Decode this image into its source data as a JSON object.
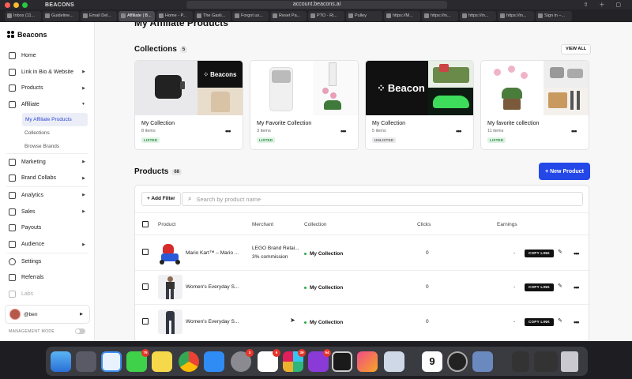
{
  "browser": {
    "app_name": "BEACONS",
    "url": "account.beacons.ai",
    "tabs": [
      {
        "label": "Inbox (11..."
      },
      {
        "label": "Guideline..."
      },
      {
        "label": "Email Del..."
      },
      {
        "label": "Affiliate | B..."
      },
      {
        "label": "Home - P..."
      },
      {
        "label": "The Gasli..."
      },
      {
        "label": "Forgot us..."
      },
      {
        "label": "Reset Pa..."
      },
      {
        "label": "PTO - Ri..."
      },
      {
        "label": "Pulley"
      },
      {
        "label": "https://M..."
      },
      {
        "label": "https://in..."
      },
      {
        "label": "https://in..."
      },
      {
        "label": "https://in..."
      },
      {
        "label": "Sign in –..."
      }
    ]
  },
  "sidebar": {
    "brand": "Beacons",
    "items": [
      {
        "label": "Home",
        "icon": "home-icon"
      },
      {
        "label": "Link in Bio & Website",
        "icon": "link-icon"
      },
      {
        "label": "Products",
        "icon": "tag-icon"
      },
      {
        "label": "Affiliate",
        "icon": "cart-icon"
      }
    ],
    "affiliate_sub": [
      "My Affiliate Products",
      "Collections",
      "Browse Brands"
    ],
    "items2": [
      {
        "label": "Marketing",
        "icon": "megaphone-icon"
      },
      {
        "label": "Brand Collabs",
        "icon": "handshake-icon"
      }
    ],
    "items3": [
      {
        "label": "Analytics",
        "icon": "chart-icon"
      },
      {
        "label": "Sales",
        "icon": "wallet-icon"
      },
      {
        "label": "Payouts",
        "icon": "bank-icon"
      },
      {
        "label": "Audience",
        "icon": "people-icon"
      }
    ],
    "items4": [
      {
        "label": "Settings",
        "icon": "gear-icon"
      },
      {
        "label": "Referrals",
        "icon": "gift-icon"
      },
      {
        "label": "Labs",
        "icon": "flask-icon"
      }
    ],
    "user": "@ben",
    "management_mode": "MANAGEMENT MODE"
  },
  "main": {
    "page_title": "My Affiliate Products",
    "collections_title": "Collections",
    "collections_count": "5",
    "view_all": "VIEW ALL",
    "collections": [
      {
        "name": "My Collection",
        "items": "8 items",
        "status": "LISTED"
      },
      {
        "name": "My Favorite Collection",
        "items": "3 items",
        "status": "LISTED"
      },
      {
        "name": "My Collection",
        "items": "5 items",
        "status": "UNLISTED"
      },
      {
        "name": "My favorite collection",
        "items": "11 items",
        "status": "LISTED"
      }
    ],
    "products_title": "Products",
    "products_count": "68",
    "new_product": "+ New Product",
    "add_filter": "+ Add Filter",
    "search_placeholder": "Search by product name",
    "columns": [
      "Product",
      "Merchant",
      "Collection",
      "Clicks",
      "Earnings"
    ],
    "rows": [
      {
        "product": "Mario Kart™ – Mario ...",
        "merchant": "LEGO Brand Retai...",
        "merchant_sub": "3% commission",
        "collection": "My Collection",
        "clicks": "0",
        "earnings": "-",
        "copy": "COPY LINK"
      },
      {
        "product": "Women's Everyday S...",
        "merchant": "",
        "merchant_sub": "",
        "collection": "My Collection",
        "clicks": "0",
        "earnings": "-",
        "copy": "COPY LINK"
      },
      {
        "product": "Women's Everyday S...",
        "merchant": "",
        "merchant_sub": "",
        "collection": "My Collection",
        "clicks": "0",
        "earnings": "-",
        "copy": "COPY LINK"
      }
    ]
  },
  "dock": {
    "badges": {
      "messages": "79",
      "system_settings": "3",
      "notion": "6",
      "slack": "39",
      "app_store_like": "94"
    },
    "calendar_day": "9"
  }
}
